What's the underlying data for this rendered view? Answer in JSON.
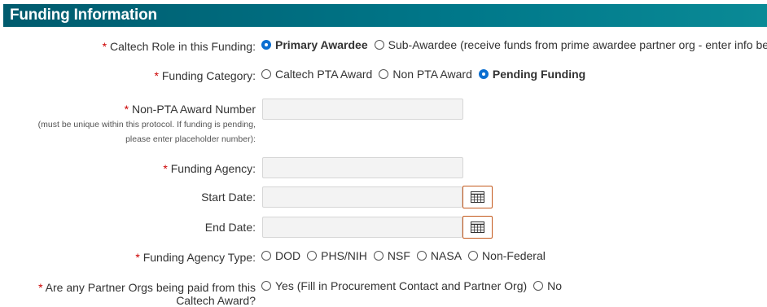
{
  "section": {
    "title": "Funding Information"
  },
  "fields": {
    "role": {
      "required": "*",
      "label": "Caltech Role in this Funding:",
      "options": [
        {
          "label": "Primary Awardee",
          "selected": true
        },
        {
          "label": "Sub-Awardee (receive funds from prime awardee partner org - enter info below)",
          "selected": false
        }
      ]
    },
    "category": {
      "required": "*",
      "label": "Funding Category:",
      "options": [
        {
          "label": "Caltech PTA Award",
          "selected": false
        },
        {
          "label": "Non PTA Award",
          "selected": false
        },
        {
          "label": "Pending Funding",
          "selected": true
        }
      ]
    },
    "award_number": {
      "required": "*",
      "label": "Non-PTA Award Number",
      "help_line1": "(must be unique within this protocol. If funding is pending,",
      "help_line2": "please enter placeholder number):",
      "value": ""
    },
    "agency": {
      "required": "*",
      "label": "Funding Agency:",
      "value": ""
    },
    "start_date": {
      "label": "Start Date:",
      "value": "",
      "icon": "calendar-icon"
    },
    "end_date": {
      "label": "End Date:",
      "value": "",
      "icon": "calendar-icon"
    },
    "agency_type": {
      "required": "*",
      "label": "Funding Agency Type:",
      "options": [
        {
          "label": "DOD",
          "selected": false
        },
        {
          "label": "PHS/NIH",
          "selected": false
        },
        {
          "label": "NSF",
          "selected": false
        },
        {
          "label": "NASA",
          "selected": false
        },
        {
          "label": "Non-Federal",
          "selected": false
        }
      ]
    },
    "partner_orgs": {
      "required": "*",
      "label_line1": "Are any Partner Orgs being paid from this",
      "label_line2": "Caltech Award?",
      "options": [
        {
          "label": "Yes (Fill in Procurement Contact and Partner Org)",
          "selected": false
        },
        {
          "label": "No",
          "selected": false
        }
      ]
    }
  },
  "colors": {
    "header_bg": "#00788a",
    "required": "#cc0000",
    "radio_selected": "#0b6fd1",
    "calendar_border": "#c45a1e"
  }
}
